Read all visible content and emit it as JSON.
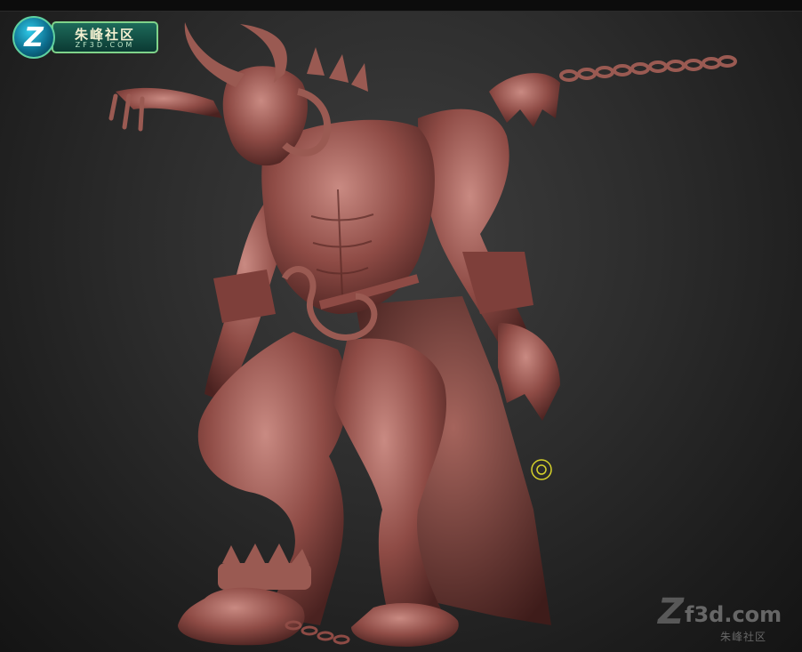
{
  "logo": {
    "title": "朱峰社区",
    "subtitle": "ZF3D.COM",
    "letter": "Z"
  },
  "viewport": {
    "subject": "demon-sculpt",
    "background_top": "#3e3e3e",
    "background_bottom": "#141414",
    "sculpt_color": "#8e4b45"
  },
  "watermark": {
    "letter": "Z",
    "site": "f3d.com",
    "name": "朱峰社区"
  }
}
